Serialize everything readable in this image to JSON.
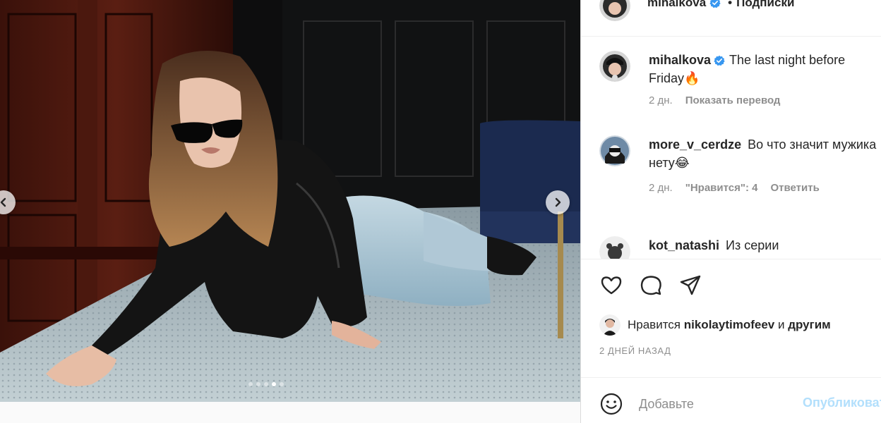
{
  "post": {
    "carousel": {
      "slide_count": 5,
      "active_slide_index": 3
    }
  },
  "header": {
    "username": "mihalkova",
    "separator": "•",
    "follow_label": "Подписки"
  },
  "comments": [
    {
      "username": "mihalkova",
      "text": "The last night before Friday🔥",
      "time": "2 дн.",
      "action": "Показать перевод"
    },
    {
      "username": "more_v_cerdze",
      "text": "Во что значит мужика нету😂",
      "time": "2 дн.",
      "likes": "\"Нравится\": 4",
      "reply": "Ответить"
    },
    {
      "username": "kot_natashi",
      "text": "Из серии"
    }
  ],
  "likes": {
    "prefix": "Нравится",
    "user": "nikolaytimofeev",
    "conj": "и",
    "others": "другим"
  },
  "date": "2 ДНЕЙ НАЗАД",
  "add_comment": {
    "placeholder": "Добавьте",
    "post_label": "Опубликовать"
  },
  "colors": {
    "verified": "#3897f0",
    "muted_text": "#8e8e8e",
    "post_button_disabled": "#b2dffc"
  },
  "icons": {
    "like": "heart-icon",
    "comment": "comment-bubble-icon",
    "share": "paper-plane-icon",
    "emoji": "smiley-icon",
    "verified": "verified-badge-icon",
    "prev": "chevron-left-icon",
    "next": "chevron-right-icon"
  }
}
